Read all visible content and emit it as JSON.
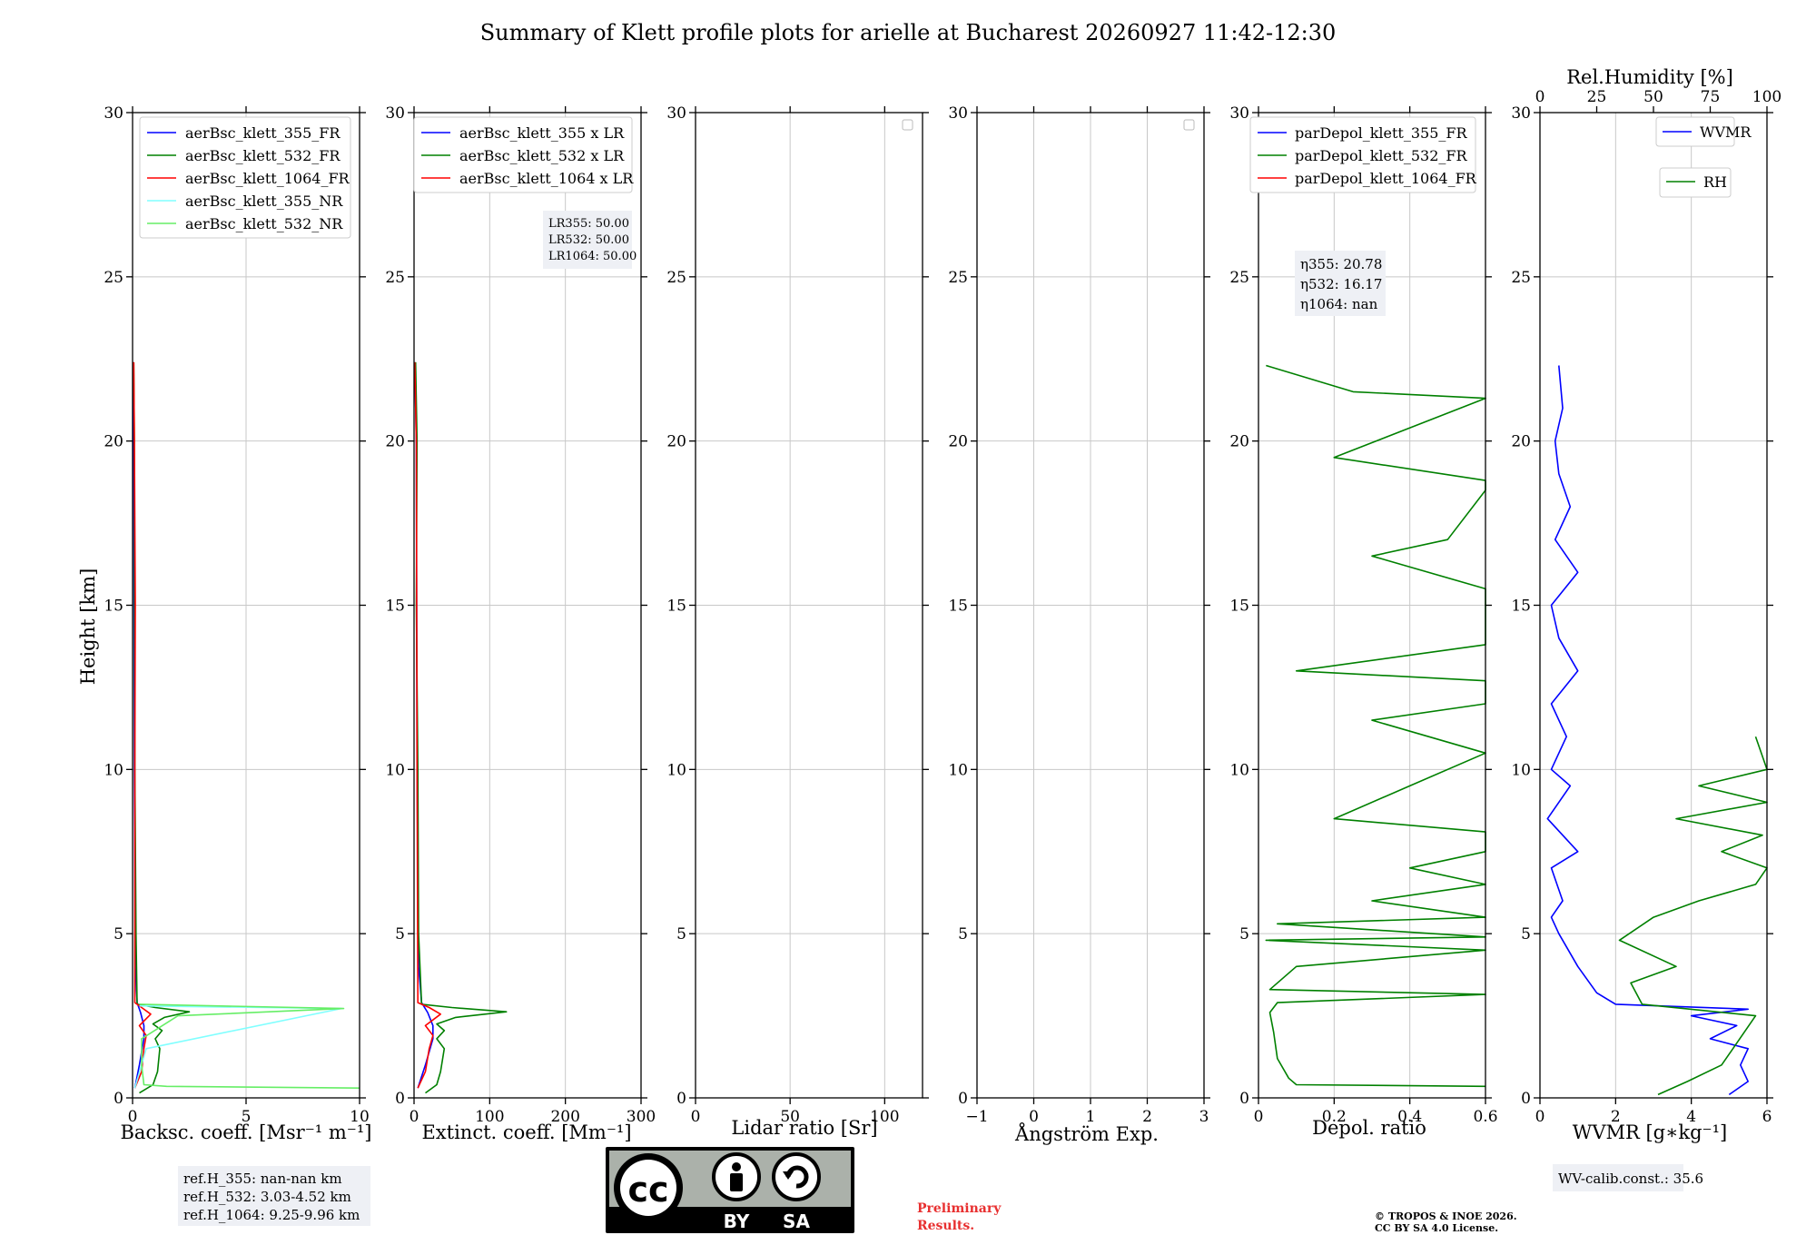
{
  "title": "Summary of Klett profile plots for arielle at Bucharest 20260927 11:42-12:30",
  "height_label": "Height [km]",
  "colors": {
    "c355": "#0000ff",
    "c532": "#008000",
    "c1064": "#ff0000",
    "c355nr": "#80ffff",
    "c532nr": "#66ee66",
    "rh": "#008000",
    "wvmr": "#0000ff"
  },
  "chart_data": [
    {
      "id": "bsc",
      "type": "line",
      "xlabel": "Backsc. coeff. [Msr⁻¹ m⁻¹]",
      "xlim": [
        0,
        10
      ],
      "ylim": [
        0,
        30
      ],
      "xticks": [
        0,
        5,
        10
      ],
      "yticks": [
        0,
        5,
        10,
        15,
        20,
        25,
        30
      ],
      "legend_position": "top-left",
      "series": [
        {
          "name": "aerBsc_klett_355_FR",
          "color": "#0000ff",
          "points": [
            [
              0.1,
              0.3
            ],
            [
              0.3,
              1.0
            ],
            [
              0.5,
              1.8
            ],
            [
              0.5,
              2.2
            ],
            [
              0.35,
              2.6
            ],
            [
              0.2,
              2.9
            ],
            [
              0.12,
              4
            ],
            [
              0.08,
              10
            ],
            [
              0.05,
              20
            ],
            [
              0.02,
              22.4
            ]
          ]
        },
        {
          "name": "aerBsc_klett_532_FR",
          "color": "#008000",
          "points": [
            [
              0.3,
              0.15
            ],
            [
              0.9,
              0.4
            ],
            [
              1.1,
              0.8
            ],
            [
              1.2,
              1.5
            ],
            [
              1.0,
              1.8
            ],
            [
              1.3,
              2.05
            ],
            [
              0.9,
              2.25
            ],
            [
              1.4,
              2.45
            ],
            [
              2.5,
              2.62
            ],
            [
              1.0,
              2.75
            ],
            [
              0.2,
              2.85
            ],
            [
              0.15,
              5
            ],
            [
              0.1,
              10
            ],
            [
              0.08,
              20
            ],
            [
              0.05,
              22.4
            ]
          ]
        },
        {
          "name": "aerBsc_klett_1064_FR",
          "color": "#ff0000",
          "points": [
            [
              0.1,
              0.3
            ],
            [
              0.4,
              0.8
            ],
            [
              0.5,
              1.5
            ],
            [
              0.6,
              1.9
            ],
            [
              0.3,
              2.2
            ],
            [
              0.8,
              2.55
            ],
            [
              0.4,
              2.75
            ],
            [
              0.1,
              2.9
            ],
            [
              0.1,
              10
            ],
            [
              0.12,
              15
            ],
            [
              0.08,
              20
            ],
            [
              0.05,
              22.4
            ]
          ]
        },
        {
          "name": "aerBsc_klett_355_NR",
          "color": "#80ffff",
          "points": [
            [
              0.1,
              0.3
            ],
            [
              0.6,
              1.5
            ],
            [
              9.2,
              2.72
            ],
            [
              0.3,
              2.8
            ]
          ]
        },
        {
          "name": "aerBsc_klett_532_NR",
          "color": "#66ee66",
          "points": [
            [
              10,
              0.3
            ],
            [
              1.5,
              0.35
            ],
            [
              0.5,
              0.4
            ],
            [
              0.4,
              1.0
            ],
            [
              0.4,
              1.8
            ],
            [
              2.0,
              2.5
            ],
            [
              9.3,
              2.72
            ],
            [
              0.3,
              2.85
            ]
          ]
        }
      ]
    },
    {
      "id": "ext",
      "type": "line",
      "xlabel": "Extinct. coeff. [Mm⁻¹]",
      "xlim": [
        0,
        300
      ],
      "ylim": [
        0,
        30
      ],
      "xticks": [
        0,
        100,
        200,
        300
      ],
      "yticks": [
        0,
        5,
        10,
        15,
        20,
        25,
        30
      ],
      "legend_position": "top-left",
      "lidar_ratios": [
        "LR355: 50.00",
        "LR532: 50.00",
        "LR1064: 50.00"
      ],
      "series": [
        {
          "name": "aerBsc_klett_355 x LR",
          "color": "#0000ff",
          "points": [
            [
              5,
              0.3
            ],
            [
              15,
              1.0
            ],
            [
              25,
              1.8
            ],
            [
              25,
              2.2
            ],
            [
              18,
              2.6
            ],
            [
              10,
              2.9
            ],
            [
              6,
              4
            ],
            [
              4,
              10
            ],
            [
              3,
              20
            ],
            [
              1,
              22.4
            ]
          ]
        },
        {
          "name": "aerBsc_klett_532 x LR",
          "color": "#008000",
          "points": [
            [
              15,
              0.15
            ],
            [
              30,
              0.4
            ],
            [
              35,
              0.8
            ],
            [
              40,
              1.5
            ],
            [
              30,
              1.8
            ],
            [
              40,
              2.05
            ],
            [
              30,
              2.25
            ],
            [
              55,
              2.45
            ],
            [
              122,
              2.62
            ],
            [
              50,
              2.75
            ],
            [
              10,
              2.85
            ],
            [
              6,
              5
            ],
            [
              5,
              10
            ],
            [
              3,
              15
            ],
            [
              4,
              20
            ],
            [
              2,
              22.4
            ]
          ]
        },
        {
          "name": "aerBsc_klett_1064 x LR",
          "color": "#ff0000",
          "points": [
            [
              5,
              0.3
            ],
            [
              15,
              0.8
            ],
            [
              20,
              1.5
            ],
            [
              25,
              1.9
            ],
            [
              15,
              2.2
            ],
            [
              35,
              2.55
            ],
            [
              20,
              2.75
            ],
            [
              5,
              2.9
            ],
            [
              4,
              10
            ],
            [
              3,
              20
            ],
            [
              1,
              22.4
            ]
          ]
        }
      ]
    },
    {
      "id": "lr",
      "type": "line",
      "xlabel": "Lidar ratio [Sr]",
      "xlim": [
        0,
        120
      ],
      "ylim": [
        0,
        30
      ],
      "xticks": [
        0,
        50,
        100
      ],
      "yticks": [
        0,
        5,
        10,
        15,
        20,
        25,
        30
      ],
      "legend_position": "top-right",
      "series": []
    },
    {
      "id": "ang",
      "type": "line",
      "xlabel": "Ångström Exp.",
      "xlim": [
        -1,
        3
      ],
      "ylim": [
        0,
        30
      ],
      "xticks": [
        -1,
        0,
        1,
        2,
        3
      ],
      "yticks": [
        0,
        5,
        10,
        15,
        20,
        25,
        30
      ],
      "legend_position": "top-right",
      "series": []
    },
    {
      "id": "depol",
      "type": "line",
      "xlabel": "Depol. ratio",
      "xlim": [
        0,
        0.6
      ],
      "ylim": [
        0,
        30
      ],
      "xticks": [
        0.0,
        0.2,
        0.4,
        0.6
      ],
      "yticks": [
        0,
        5,
        10,
        15,
        20,
        25,
        30
      ],
      "legend_position": "top-left",
      "eta": [
        "η355: 20.78",
        "η532: 16.17",
        "η1064: nan"
      ],
      "series": [
        {
          "name": "parDepol_klett_355_FR",
          "color": "#0000ff",
          "points": []
        },
        {
          "name": "parDepol_klett_532_FR",
          "color": "#008000",
          "points": [
            [
              0.6,
              0.35
            ],
            [
              0.1,
              0.4
            ],
            [
              0.08,
              0.6
            ],
            [
              0.05,
              1.2
            ],
            [
              0.04,
              2.0
            ],
            [
              0.03,
              2.6
            ],
            [
              0.05,
              2.9
            ],
            [
              0.6,
              3.15
            ],
            [
              0.03,
              3.3
            ],
            [
              0.1,
              4.0
            ],
            [
              0.6,
              4.5
            ],
            [
              0.02,
              4.8
            ],
            [
              0.6,
              4.9
            ],
            [
              0.05,
              5.3
            ],
            [
              0.6,
              5.5
            ],
            [
              0.3,
              6.0
            ],
            [
              0.6,
              6.5
            ],
            [
              0.4,
              7.0
            ],
            [
              0.6,
              7.5
            ],
            [
              0.6,
              8.1
            ],
            [
              0.2,
              8.5
            ],
            [
              0.4,
              9.5
            ],
            [
              0.6,
              10.5
            ],
            [
              0.3,
              11.5
            ],
            [
              0.6,
              12.0
            ],
            [
              0.6,
              12.7
            ],
            [
              0.1,
              13.0
            ],
            [
              0.6,
              13.8
            ],
            [
              0.6,
              14.1
            ],
            [
              0.6,
              15.5
            ],
            [
              0.3,
              16.5
            ],
            [
              0.5,
              17.0
            ],
            [
              0.6,
              18.5
            ],
            [
              0.6,
              18.8
            ],
            [
              0.2,
              19.5
            ],
            [
              0.6,
              21.3
            ],
            [
              0.25,
              21.5
            ],
            [
              0.02,
              22.3
            ]
          ]
        },
        {
          "name": "parDepol_klett_1064_FR",
          "color": "#ff0000",
          "points": []
        }
      ]
    },
    {
      "id": "wv",
      "type": "line",
      "xlabel": "WVMR [g∗kg⁻¹]",
      "top_label": "Rel.Humidity [%]",
      "xlim": [
        0,
        6
      ],
      "ylim": [
        0,
        30
      ],
      "xticks": [
        0,
        2,
        4,
        6
      ],
      "yticks": [
        0,
        5,
        10,
        15,
        20,
        25,
        30
      ],
      "top_xlim": [
        0,
        100
      ],
      "top_xticks": [
        0,
        25,
        50,
        75,
        100
      ],
      "legend_position": "top-right",
      "series": [
        {
          "name": "WVMR",
          "color": "#0000ff",
          "axis": "bottom",
          "points": [
            [
              5.0,
              0.1
            ],
            [
              5.5,
              0.5
            ],
            [
              5.3,
              1.0
            ],
            [
              5.5,
              1.5
            ],
            [
              4.5,
              1.8
            ],
            [
              5.2,
              2.2
            ],
            [
              4.0,
              2.5
            ],
            [
              5.5,
              2.7
            ],
            [
              2.0,
              2.85
            ],
            [
              1.5,
              3.2
            ],
            [
              1.0,
              4.0
            ],
            [
              0.5,
              5.0
            ],
            [
              0.3,
              5.5
            ],
            [
              0.6,
              6.0
            ],
            [
              0.3,
              7.0
            ],
            [
              1.0,
              7.5
            ],
            [
              0.2,
              8.5
            ],
            [
              0.8,
              9.5
            ],
            [
              0.3,
              10.0
            ],
            [
              0.7,
              11.0
            ],
            [
              0.3,
              12.0
            ],
            [
              1.0,
              13.0
            ],
            [
              0.5,
              14.0
            ],
            [
              0.3,
              15.0
            ],
            [
              1.0,
              16.0
            ],
            [
              0.4,
              17.0
            ],
            [
              0.8,
              18.0
            ],
            [
              0.5,
              19.0
            ],
            [
              0.4,
              20.0
            ],
            [
              0.6,
              21.0
            ],
            [
              0.5,
              22.3
            ]
          ]
        },
        {
          "name": "RH",
          "color": "#008000",
          "axis": "top",
          "points": [
            [
              52,
              0.1
            ],
            [
              65,
              0.5
            ],
            [
              80,
              1.0
            ],
            [
              85,
              1.5
            ],
            [
              90,
              2.0
            ],
            [
              95,
              2.5
            ],
            [
              45,
              2.85
            ],
            [
              40,
              3.5
            ],
            [
              60,
              4.0
            ],
            [
              35,
              4.8
            ],
            [
              50,
              5.5
            ],
            [
              70,
              6.0
            ],
            [
              95,
              6.5
            ],
            [
              100,
              7.0
            ],
            [
              80,
              7.5
            ],
            [
              98,
              8.0
            ],
            [
              60,
              8.5
            ],
            [
              100,
              9.0
            ],
            [
              70,
              9.5
            ],
            [
              100,
              10.0
            ],
            [
              95,
              11.0
            ]
          ]
        }
      ]
    }
  ],
  "refs": [
    "ref.H_355: nan-nan km",
    "ref.H_532: 3.03-4.52 km",
    "ref.H_1064: 9.25-9.96 km"
  ],
  "wv_calib": "WV-calib.const.: 35.6",
  "license_badge": {
    "cc": "cc",
    "by": "BY",
    "sa": "SA"
  },
  "preliminary": [
    "Preliminary",
    "Results."
  ],
  "copyright": [
    "© TROPOS & INOE 2026.",
    "CC BY SA 4.0 License."
  ]
}
